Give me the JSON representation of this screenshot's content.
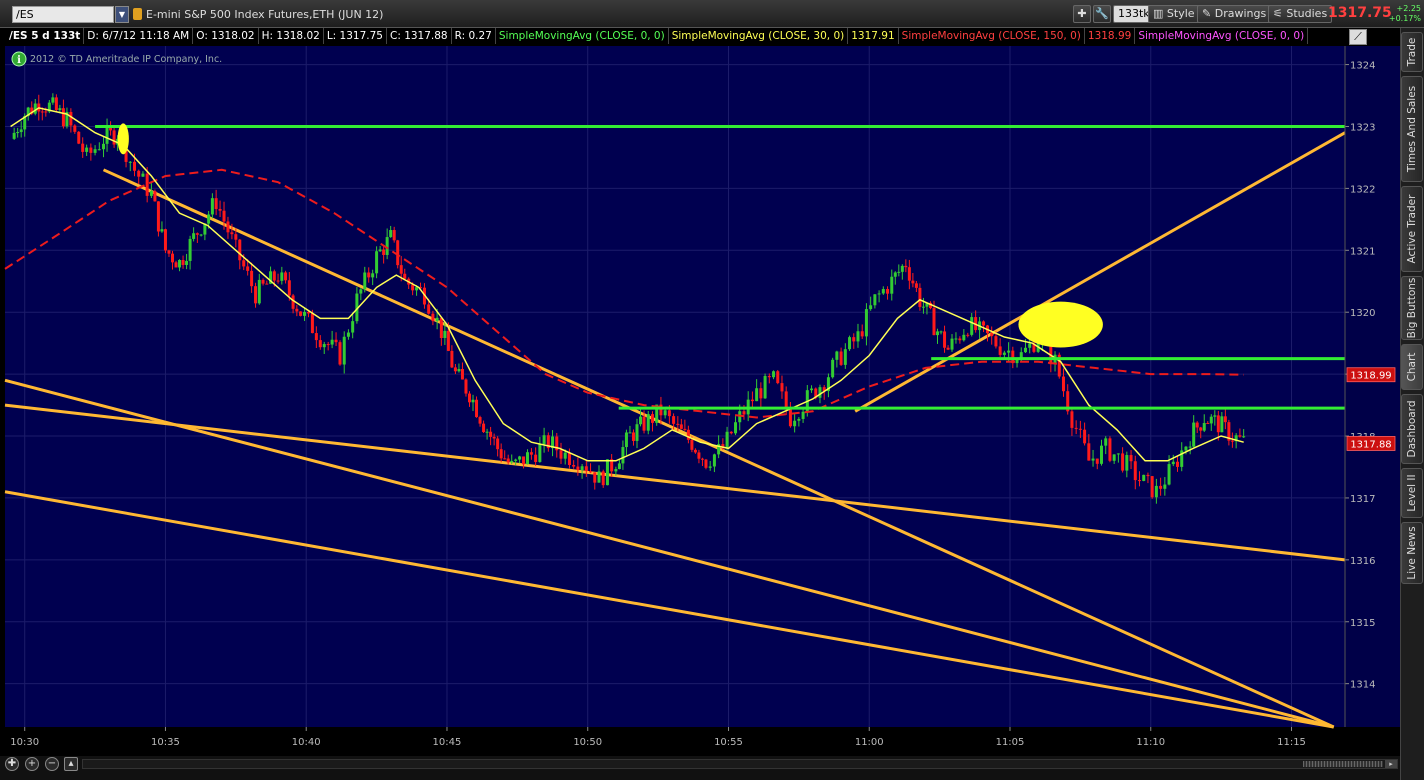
{
  "toolbar": {
    "symbol": "/ES",
    "instrument_title": "E-mini S&P 500 Index Futures,ETH (JUN 12)",
    "tick_button": "133tk",
    "style_label": "Style",
    "drawings_label": "Drawings",
    "studies_label": "Studies",
    "last_price": "1317.75",
    "change_abs": "+2.25",
    "change_pct": "+0.17%"
  },
  "infobar": {
    "aggregation": "/ES 5 d 133t",
    "date": "D: 6/7/12 11:18 AM",
    "open": "O: 1318.02",
    "high": "H: 1318.02",
    "low": "L: 1317.75",
    "close": "C: 1317.88",
    "range": "R: 0.27",
    "sma1": "SimpleMovingAvg (CLOSE, 0, 0)",
    "sma2": "SimpleMovingAvg (CLOSE, 30, 0)",
    "sma2_value": "1317.91",
    "sma3": "SimpleMovingAvg (CLOSE, 150, 0)",
    "sma3_value": "1318.99",
    "sma4": "SimpleMovingAvg (CLOSE, 0, 0)"
  },
  "copyright": "2012 © TD Ameritrade IP Company, Inc.",
  "right_tabs": [
    "Trade",
    "Times And Sales",
    "Active Trader",
    "Big Buttons",
    "Chart",
    "Dashboard",
    "Level II",
    "Live News"
  ],
  "active_tab": "Chart",
  "icons": {
    "info": "info-circle-icon",
    "zoom_fit": "crosshair-icon",
    "zoom_in": "zoom-in-icon",
    "zoom_out": "zoom-out-icon",
    "drawing_tool": "pencil-icon",
    "settings": "wrench-icon"
  },
  "colors": {
    "background": "#000050",
    "bull": "#33cc33",
    "bear": "#ff1a1a",
    "sma30": "#ffff55",
    "sma150": "#ee1c1c",
    "trendline": "#ffb833",
    "hline": "#33ee33",
    "highlight": "#ffff22"
  },
  "chart_data": {
    "type": "candlestick",
    "ylim": [
      1313.3,
      1324.3
    ],
    "y_ticks": [
      1314,
      1315,
      1316,
      1317,
      1318,
      1319,
      1320,
      1321,
      1322,
      1323,
      1324
    ],
    "x_ticks": [
      "10:30",
      "10:35",
      "10:40",
      "10:45",
      "10:50",
      "10:55",
      "11:00",
      "11:05",
      "11:10",
      "11:15"
    ],
    "x_range_minutes": [
      29.3,
      56.9
    ],
    "price_labels": [
      {
        "value": 1318.99,
        "text": "1318.99",
        "series": "SMA 150"
      },
      {
        "value": 1317.88,
        "text": "1317.88",
        "series": "last"
      }
    ],
    "close_path": [
      [
        29.5,
        1322.8
      ],
      [
        30.0,
        1323.2
      ],
      [
        30.5,
        1323.4
      ],
      [
        31.0,
        1323.3
      ],
      [
        31.5,
        1323.1
      ],
      [
        32.2,
        1322.5
      ],
      [
        32.8,
        1322.8
      ],
      [
        33.3,
        1322.9
      ],
      [
        33.9,
        1322.3
      ],
      [
        34.5,
        1321.9
      ],
      [
        35.0,
        1321.0
      ],
      [
        35.5,
        1320.8
      ],
      [
        36.0,
        1321.2
      ],
      [
        36.8,
        1321.8
      ],
      [
        37.5,
        1321.0
      ],
      [
        38.2,
        1320.3
      ],
      [
        39.0,
        1320.6
      ],
      [
        39.8,
        1320.0
      ],
      [
        40.5,
        1319.6
      ],
      [
        41.2,
        1319.3
      ],
      [
        41.8,
        1320.2
      ],
      [
        42.5,
        1320.9
      ],
      [
        43.0,
        1321.2
      ],
      [
        43.5,
        1320.5
      ],
      [
        44.2,
        1320.3
      ],
      [
        44.8,
        1319.7
      ],
      [
        45.3,
        1319.0
      ],
      [
        45.8,
        1318.7
      ],
      [
        46.3,
        1318.2
      ],
      [
        46.8,
        1317.8
      ],
      [
        47.3,
        1317.5
      ],
      [
        48.0,
        1317.7
      ],
      [
        48.6,
        1317.9
      ],
      [
        49.2,
        1317.7
      ],
      [
        49.8,
        1317.6
      ],
      [
        50.4,
        1317.3
      ],
      [
        51.0,
        1317.6
      ],
      [
        51.5,
        1318.0
      ],
      [
        52.0,
        1318.2
      ],
      [
        52.6,
        1318.4
      ],
      [
        53.2,
        1318.1
      ],
      [
        53.7,
        1317.9
      ],
      [
        54.2,
        1317.6
      ],
      [
        54.8,
        1317.8
      ],
      [
        55.4,
        1318.3
      ],
      [
        56.0,
        1318.7
      ],
      [
        56.6,
        1318.9
      ],
      [
        57.2,
        1318.3
      ],
      [
        57.8,
        1318.6
      ],
      [
        58.4,
        1318.9
      ],
      [
        59.0,
        1319.3
      ],
      [
        59.6,
        1319.6
      ],
      [
        60.2,
        1320.2
      ],
      [
        60.8,
        1320.5
      ],
      [
        61.3,
        1320.8
      ],
      [
        61.8,
        1320.2
      ],
      [
        62.3,
        1319.8
      ],
      [
        62.8,
        1319.4
      ],
      [
        63.5,
        1319.8
      ],
      [
        64.2,
        1319.6
      ],
      [
        64.8,
        1319.4
      ],
      [
        65.4,
        1319.3
      ],
      [
        66.0,
        1319.6
      ],
      [
        66.6,
        1319.2
      ],
      [
        67.2,
        1318.3
      ],
      [
        67.8,
        1317.6
      ],
      [
        68.4,
        1317.8
      ],
      [
        69.0,
        1317.6
      ],
      [
        69.6,
        1317.3
      ],
      [
        70.2,
        1317.1
      ],
      [
        70.8,
        1317.5
      ],
      [
        71.4,
        1318.0
      ],
      [
        71.9,
        1318.3
      ],
      [
        72.4,
        1318.2
      ],
      [
        72.9,
        1318.0
      ],
      [
        73.3,
        1317.9
      ]
    ],
    "sma30_path": [
      [
        29.5,
        1323.0
      ],
      [
        30.5,
        1323.3
      ],
      [
        31.5,
        1323.2
      ],
      [
        32.5,
        1322.9
      ],
      [
        33.5,
        1322.7
      ],
      [
        34.5,
        1322.2
      ],
      [
        35.5,
        1321.6
      ],
      [
        36.5,
        1321.4
      ],
      [
        37.5,
        1321.0
      ],
      [
        38.5,
        1320.6
      ],
      [
        39.5,
        1320.2
      ],
      [
        40.5,
        1319.9
      ],
      [
        41.5,
        1319.9
      ],
      [
        42.5,
        1320.4
      ],
      [
        43.2,
        1320.6
      ],
      [
        44.0,
        1320.4
      ],
      [
        45.0,
        1319.8
      ],
      [
        46.0,
        1318.9
      ],
      [
        47.0,
        1318.2
      ],
      [
        48.0,
        1317.9
      ],
      [
        49.0,
        1317.8
      ],
      [
        50.0,
        1317.6
      ],
      [
        51.0,
        1317.6
      ],
      [
        52.0,
        1317.8
      ],
      [
        53.0,
        1318.1
      ],
      [
        54.0,
        1317.9
      ],
      [
        55.0,
        1317.8
      ],
      [
        56.0,
        1318.2
      ],
      [
        57.0,
        1318.4
      ],
      [
        58.0,
        1318.6
      ],
      [
        59.0,
        1318.9
      ],
      [
        60.0,
        1319.3
      ],
      [
        61.0,
        1319.9
      ],
      [
        61.8,
        1320.2
      ],
      [
        62.8,
        1320.0
      ],
      [
        63.8,
        1319.8
      ],
      [
        64.8,
        1319.6
      ],
      [
        65.8,
        1319.5
      ],
      [
        66.8,
        1319.2
      ],
      [
        67.8,
        1318.5
      ],
      [
        68.8,
        1318.1
      ],
      [
        69.8,
        1317.6
      ],
      [
        70.6,
        1317.6
      ],
      [
        71.5,
        1317.8
      ],
      [
        72.5,
        1318.0
      ],
      [
        73.3,
        1317.9
      ]
    ],
    "sma150_path": [
      [
        29.3,
        1320.7
      ],
      [
        31.0,
        1321.2
      ],
      [
        33.0,
        1321.8
      ],
      [
        35.0,
        1322.2
      ],
      [
        37.0,
        1322.3
      ],
      [
        39.0,
        1322.1
      ],
      [
        41.0,
        1321.6
      ],
      [
        43.0,
        1321.0
      ],
      [
        45.0,
        1320.4
      ],
      [
        47.0,
        1319.6
      ],
      [
        48.5,
        1319.0
      ],
      [
        50.0,
        1318.7
      ],
      [
        52.0,
        1318.5
      ],
      [
        54.0,
        1318.4
      ],
      [
        56.0,
        1318.3
      ],
      [
        58.0,
        1318.4
      ],
      [
        60.0,
        1318.8
      ],
      [
        62.0,
        1319.1
      ],
      [
        64.0,
        1319.2
      ],
      [
        66.0,
        1319.2
      ],
      [
        68.0,
        1319.1
      ],
      [
        70.0,
        1319.0
      ],
      [
        72.0,
        1319.0
      ],
      [
        73.3,
        1318.99
      ]
    ],
    "trendlines": [
      {
        "from": [
          32.8,
          1322.3
        ],
        "to": [
          56.5,
          1313.3
        ]
      },
      {
        "from": [
          29.3,
          1318.9
        ],
        "to": [
          56.5,
          1313.3
        ]
      },
      {
        "from": [
          29.3,
          1317.1
        ],
        "to": [
          56.5,
          1313.3
        ]
      },
      {
        "from": [
          29.3,
          1318.5
        ],
        "to": [
          56.9,
          1316.0
        ]
      },
      {
        "from": [
          59.5,
          1318.4
        ],
        "to": [
          56.9,
          1322.9
        ]
      }
    ],
    "horizontal_lines": [
      {
        "from": 32.5,
        "to": 56.9,
        "value": 1323.0
      },
      {
        "from": 51.1,
        "to": 60.5,
        "value": 1318.45
      },
      {
        "from": 62.2,
        "to": 67.5,
        "value": 1319.25
      }
    ],
    "highlights": [
      {
        "at": 33.5,
        "value": 1322.8,
        "rx": 0.2,
        "ry": 0.25
      },
      {
        "at": 66.8,
        "value": 1319.8,
        "rx": 1.5,
        "ry": 0.37
      }
    ]
  }
}
